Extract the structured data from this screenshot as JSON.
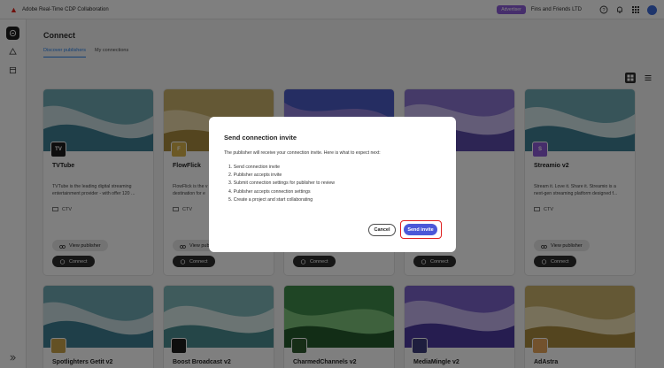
{
  "header": {
    "app_title": "Adobe Real-Time CDP Collaboration",
    "role_badge": "Advertiser",
    "org_name": "Fins and Friends LTD"
  },
  "page": {
    "title": "Connect",
    "tabs": [
      {
        "label": "Discover publishers",
        "active": true
      },
      {
        "label": "My connections",
        "active": false
      }
    ]
  },
  "cards": [
    {
      "name": "TVTube",
      "logo_text": "TV",
      "logo_color": "#1c1c1c",
      "desc_1": "TVTube is the leading digital streaming",
      "desc_2": "entertainment provider - with offer 120 ...",
      "channel": "CTV",
      "view_label": "View publisher",
      "connect_label": "Connect",
      "theme": "teal"
    },
    {
      "name": "FlowFlick",
      "logo_text": "F",
      "logo_color": "#d8b24a",
      "desc_1": "FlowFlick is the v",
      "desc_2": "destination for e",
      "channel": "CTV",
      "view_label": "View pub",
      "connect_label": "Connect",
      "theme": "gold"
    },
    {
      "name": "",
      "logo_text": "",
      "logo_color": "#3b4fb8",
      "desc_1": "",
      "desc_2": "",
      "channel": "",
      "view_label": "",
      "connect_label": "Connect",
      "theme": "blue"
    },
    {
      "name": "",
      "logo_text": "",
      "logo_color": "#6b5ab8",
      "desc_1": "ine is a premium",
      "desc_2": "eaming platform ...",
      "channel": "",
      "view_label": "",
      "connect_label": "Connect",
      "theme": "violet"
    },
    {
      "name": "Streamio v2",
      "logo_text": "S",
      "logo_color": "#8c5bd6",
      "desc_1": "Stream it. Love it. Share it. Streamio is a",
      "desc_2": "next-gen streaming platform designed f...",
      "channel": "CTV",
      "view_label": "View publisher",
      "connect_label": "Connect",
      "theme": "teal"
    }
  ],
  "cards_row2": [
    {
      "name": "Spotlighters Getit v2",
      "theme": "teal",
      "logo_color": "#c9a24a"
    },
    {
      "name": "Boost Broadcast v2",
      "theme": "teal2",
      "logo_color": "#1c1c1c"
    },
    {
      "name": "CharmedChannels v2",
      "theme": "green",
      "logo_color": "#2f5a2f"
    },
    {
      "name": "MediaMingle v2",
      "theme": "violet",
      "logo_color": "#3c3c7c"
    },
    {
      "name": "AdAstra",
      "theme": "gold",
      "logo_color": "#e7a45a"
    }
  ],
  "dialog": {
    "title": "Send connection invite",
    "intro": "The publisher will receive your connection invite. Here is what to expect next:",
    "steps": [
      "1. Send connection invite",
      "2. Publisher accepts invite",
      "3. Submit connection settings for publisher to review",
      "4. Publisher accepts connection settings",
      "5. Create a project and start collaborating"
    ],
    "cancel_label": "Cancel",
    "send_label": "Send invite"
  },
  "icons": {
    "brand": "adobe-logo-icon",
    "help": "help-icon",
    "bell": "notification-bell-icon",
    "apps": "app-grid-icon"
  }
}
